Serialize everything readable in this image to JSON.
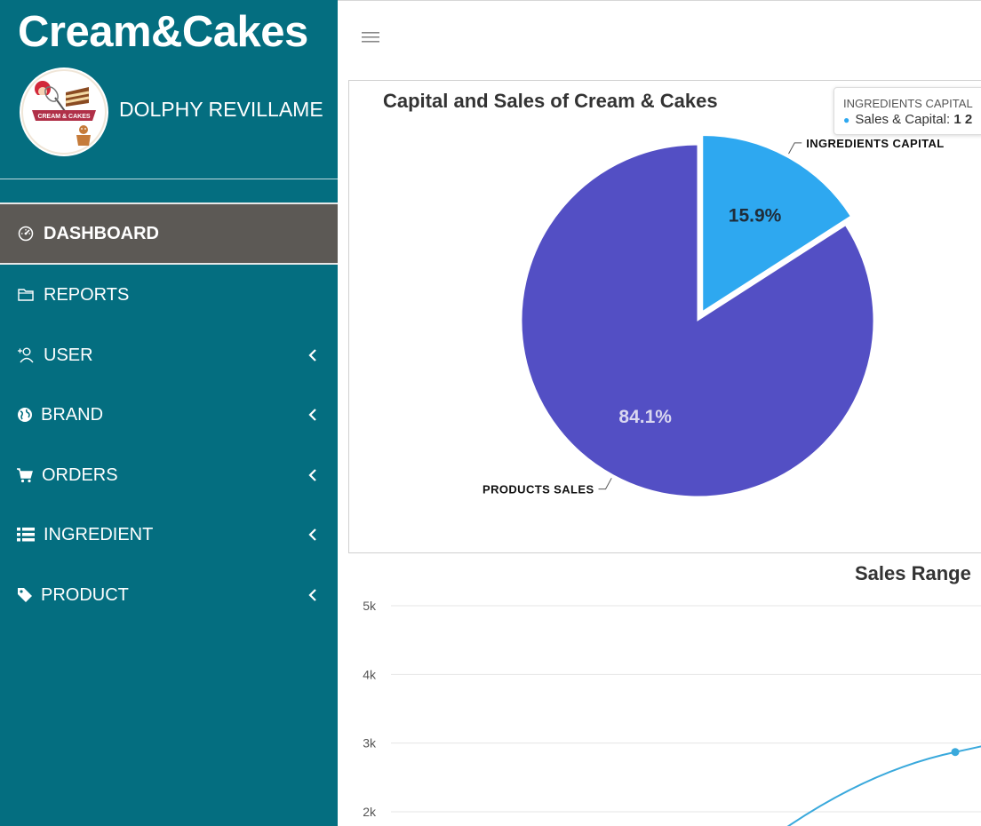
{
  "sidebar": {
    "brand": "Cream&Cakes",
    "user_name": "DOLPHY REVILLAME",
    "logo_text": "CREAM & CAKES",
    "items": [
      {
        "label": "DASHBOARD",
        "icon": "dashboard-gauge-icon",
        "active": true
      },
      {
        "label": "REPORTS",
        "icon": "folder-icon"
      },
      {
        "label": "USER",
        "icon": "user-add-icon",
        "chevron": true
      },
      {
        "label": "BRAND",
        "icon": "globe-icon",
        "chevron": true
      },
      {
        "label": "ORDERS",
        "icon": "cart-icon",
        "chevron": true
      },
      {
        "label": "INGREDIENT",
        "icon": "list-icon",
        "chevron": true
      },
      {
        "label": "PRODUCT",
        "icon": "tag-icon",
        "chevron": true
      }
    ]
  },
  "colors": {
    "sidebar_bg": "#046e80",
    "active_bg": "#5c5955",
    "series_capital": "#2ea8f0",
    "series_sales": "#534fc4",
    "line": "#3aa9dc"
  },
  "chart_data": [
    {
      "type": "pie",
      "title": "Capital and Sales of Cream & Cakes",
      "slices": [
        {
          "name": "INGREDIENTS CAPITAL",
          "value": 15.9,
          "label": "15.9%",
          "color": "#2ea8f0",
          "sliced": true
        },
        {
          "name": "PRODUCTS SALES",
          "value": 84.1,
          "label": "84.1%",
          "color": "#534fc4"
        }
      ],
      "tooltip": {
        "title": "INGREDIENTS CAPITAL",
        "series": "Sales & Capital",
        "value": "1 2"
      }
    },
    {
      "type": "line",
      "title": "Sales Range",
      "yticks": [
        "5k",
        "4k",
        "3k",
        "2k"
      ],
      "ylim": [
        2000,
        5000
      ],
      "grid": true,
      "visible_points": [
        {
          "y": 2870
        }
      ]
    }
  ]
}
